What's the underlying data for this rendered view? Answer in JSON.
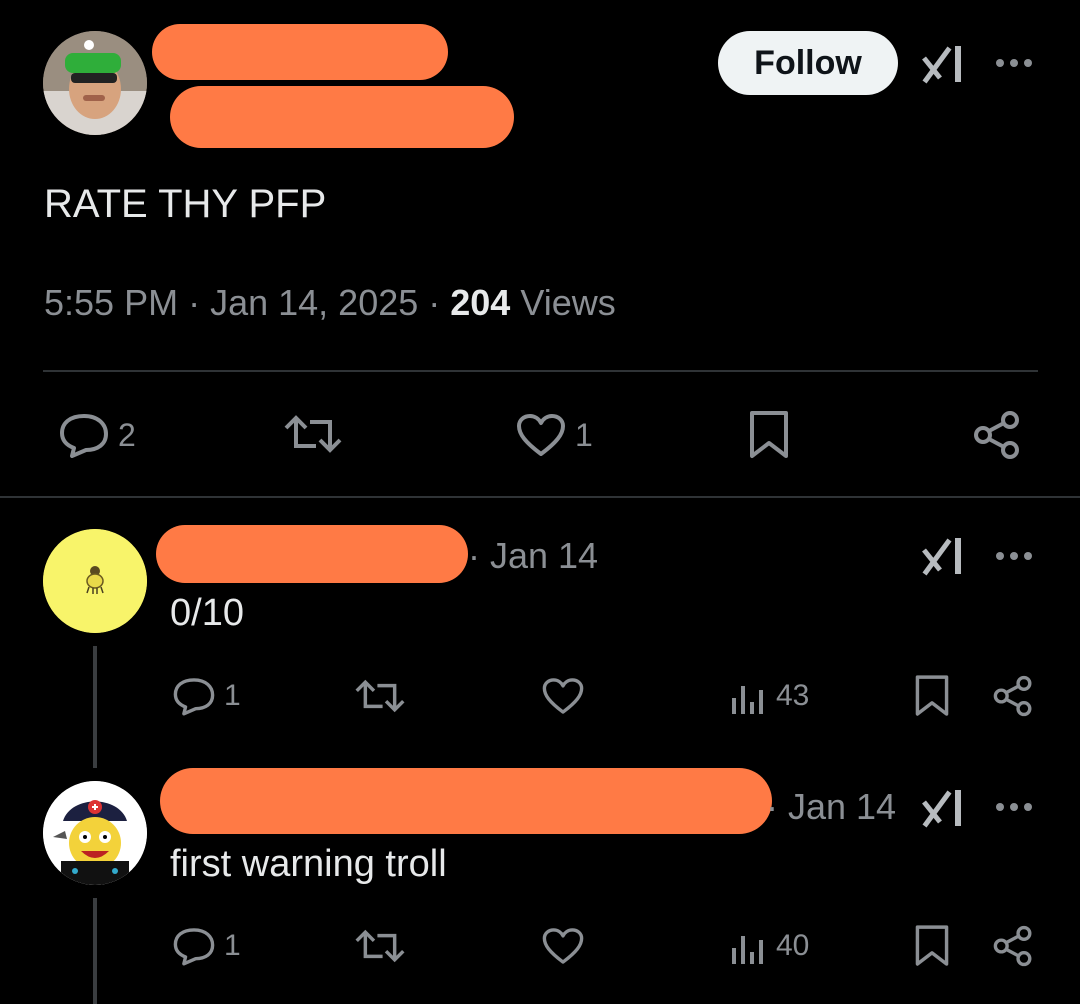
{
  "main_post": {
    "follow_label": "Follow",
    "text": "RATE THY PFP",
    "time": "5:55 PM",
    "date": "Jan 14, 2025",
    "separator": "·",
    "views_count": "204",
    "views_label": "Views",
    "actions": {
      "replies": "2",
      "reposts": "",
      "likes": "1"
    }
  },
  "replies": [
    {
      "date": "· Jan 14",
      "text": "0/10",
      "reply_count": "1",
      "repost_count": "",
      "like_count": "",
      "views_count": "43"
    },
    {
      "date": "· Jan 14",
      "text": "first warning troll",
      "reply_count": "1",
      "repost_count": "",
      "like_count": "",
      "views_count": "40"
    }
  ],
  "colors": {
    "background": "#000000",
    "text": "#e7e9ea",
    "muted": "#8b8f94",
    "redaction": "#ff7a45",
    "follow_bg": "#eff3f4",
    "divider": "#2f3336"
  },
  "icons": [
    "grok-icon",
    "more-icon",
    "reply-icon",
    "repost-icon",
    "like-icon",
    "bookmark-icon",
    "share-icon",
    "views-icon"
  ]
}
